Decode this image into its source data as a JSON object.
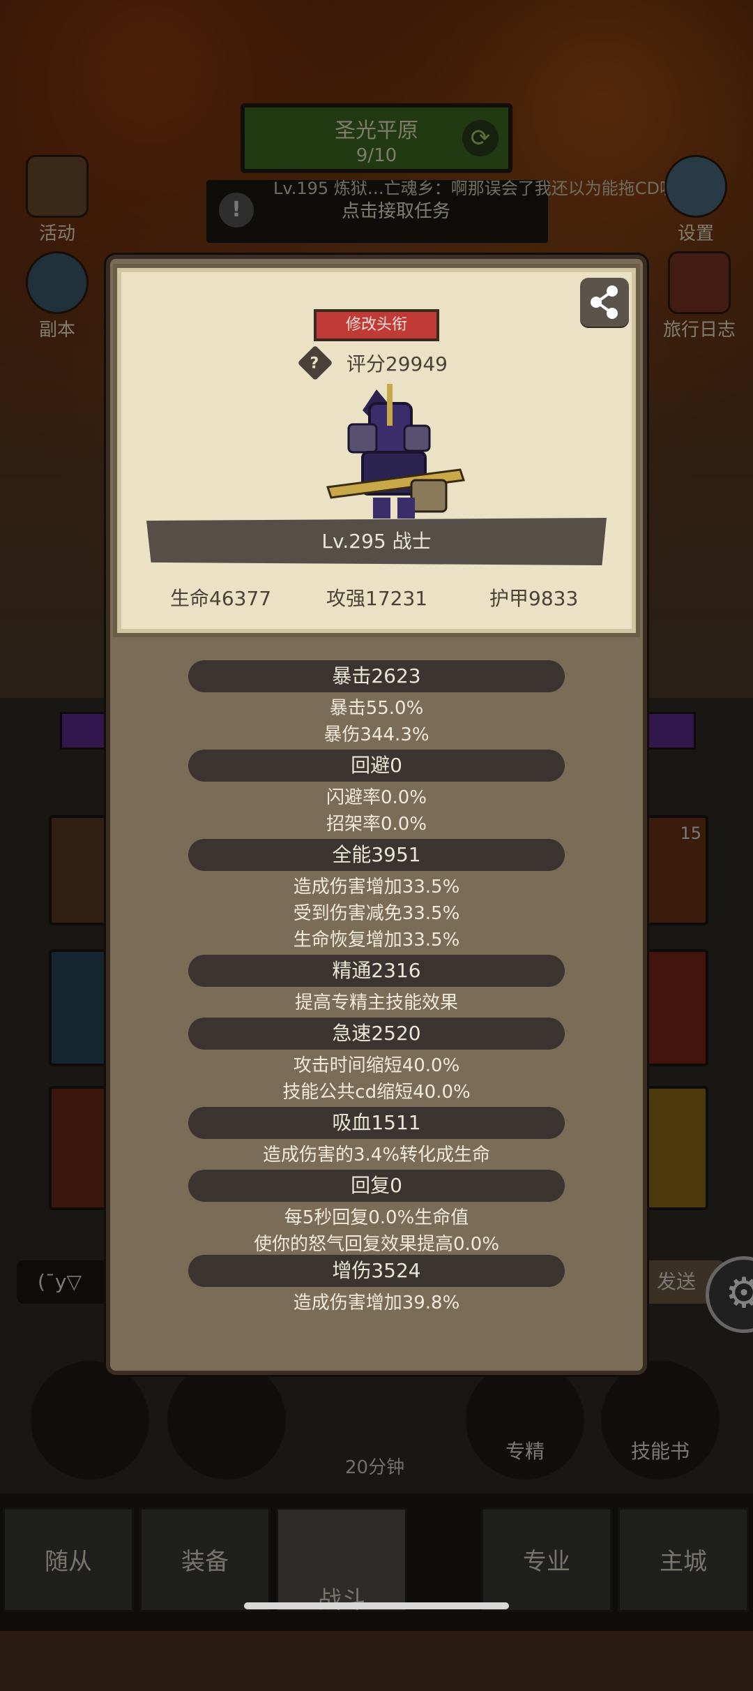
{
  "map": {
    "name": "圣光平原",
    "progress": "9/10"
  },
  "quest": {
    "chat": "Lv.195 炼狱…亡魂乡：啊那误会了我还以为能拖CD呢",
    "text": "点击接取任务"
  },
  "side_left": [
    "活动",
    "副本"
  ],
  "side_right": [
    "设置",
    "旅行日志"
  ],
  "chat_input": "(¯y▽",
  "send_label": "发送",
  "side_badge": "15",
  "round_buttons": {
    "chest_timer": "20分钟",
    "mastery": "专精",
    "skillbook": "技能书"
  },
  "nav": [
    "随从",
    "装备",
    "战斗",
    "专业",
    "主城"
  ],
  "card": {
    "title_button": "修改头衔",
    "score": "评分29949",
    "level_class": "Lv.295 战士",
    "hp": "生命46377",
    "attack": "攻强17231",
    "armor": "护甲9833"
  },
  "stats": {
    "crit": {
      "head": "暴击2623",
      "lines": [
        "暴击55.0%",
        "暴伤344.3%"
      ]
    },
    "dodge": {
      "head": "回避0",
      "lines": [
        "闪避率0.0%",
        "招架率0.0%"
      ]
    },
    "versatility": {
      "head": "全能3951",
      "lines": [
        "造成伤害增加33.5%",
        "受到伤害减免33.5%",
        "生命恢复增加33.5%"
      ]
    },
    "mastery": {
      "head": "精通2316",
      "lines": [
        "提高专精主技能效果"
      ]
    },
    "haste": {
      "head": "急速2520",
      "lines": [
        "攻击时间缩短40.0%",
        "技能公共cd缩短40.0%"
      ]
    },
    "leech": {
      "head": "吸血1511",
      "lines": [
        "造成伤害的3.4%转化成生命"
      ]
    },
    "regen": {
      "head": "回复0",
      "lines": [
        "每5秒回复0.0%生命值",
        "使你的怒气回复效果提高0.0%"
      ]
    },
    "dmg": {
      "head": "增伤3524",
      "lines": [
        "造成伤害增加39.8%"
      ]
    }
  }
}
